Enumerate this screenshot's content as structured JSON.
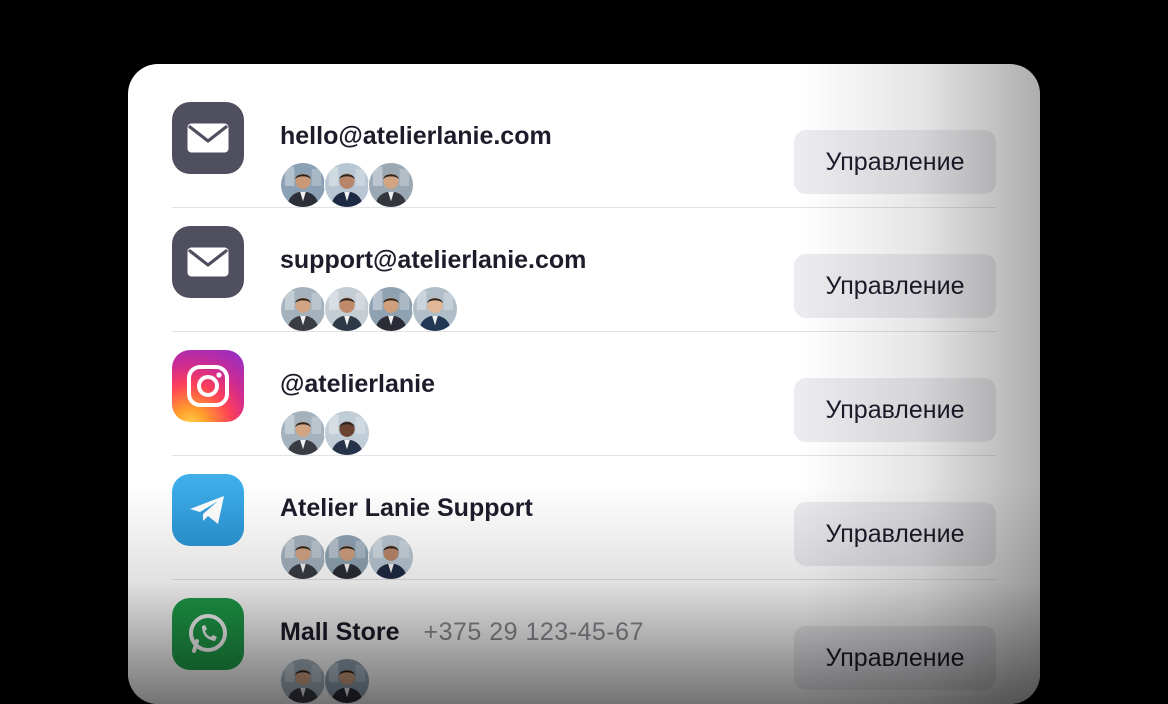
{
  "accounts": [
    {
      "icon": "mail-icon",
      "title": "hello@atelierlanie.com",
      "phone": "",
      "manage_label": "Управление",
      "avatars": [
        {
          "bg": "#8aa0b4",
          "suit": "#2c2f38",
          "skin": "#c89878"
        },
        {
          "bg": "#b7c6d2",
          "suit": "#1e2a44",
          "skin": "#b9856a"
        },
        {
          "bg": "#9aa8b4",
          "suit": "#34363d",
          "skin": "#d2a484"
        }
      ]
    },
    {
      "icon": "mail-icon",
      "title": "support@atelierlanie.com",
      "phone": "",
      "manage_label": "Управление",
      "avatars": [
        {
          "bg": "#a4b2be",
          "suit": "#3a3c44",
          "skin": "#d2a484"
        },
        {
          "bg": "#c4ccd4",
          "suit": "#2e3948",
          "skin": "#c08a6a"
        },
        {
          "bg": "#8fa2b2",
          "suit": "#2a2d36",
          "skin": "#cf9f7e"
        },
        {
          "bg": "#b0bec8",
          "suit": "#223754",
          "skin": "#e0b898"
        }
      ]
    },
    {
      "icon": "instagram-icon",
      "title": "@atelierlanie",
      "phone": "",
      "manage_label": "Управление",
      "avatars": [
        {
          "bg": "#a4b2be",
          "suit": "#3a3c44",
          "skin": "#d2a484"
        },
        {
          "bg": "#c0ccd6",
          "suit": "#26324a",
          "skin": "#6a4430"
        }
      ]
    },
    {
      "icon": "telegram-icon",
      "title": "Atelier Lanie Support",
      "phone": "",
      "manage_label": "Управление",
      "avatars": [
        {
          "bg": "#a4b2be",
          "suit": "#3a3c44",
          "skin": "#d2a484"
        },
        {
          "bg": "#8fa2b2",
          "suit": "#2a2d36",
          "skin": "#cf9f7e"
        },
        {
          "bg": "#b7c6d2",
          "suit": "#1e2a44",
          "skin": "#b9856a"
        }
      ]
    },
    {
      "icon": "whatsapp-icon",
      "title": "Mall Store",
      "phone": "+375 29 123-45-67",
      "manage_label": "Управление",
      "avatars": [
        {
          "bg": "#a4b2be",
          "suit": "#3a3c44",
          "skin": "#d2a484"
        },
        {
          "bg": "#8fa2b2",
          "suit": "#2a2d36",
          "skin": "#cf9f7e"
        }
      ]
    }
  ]
}
